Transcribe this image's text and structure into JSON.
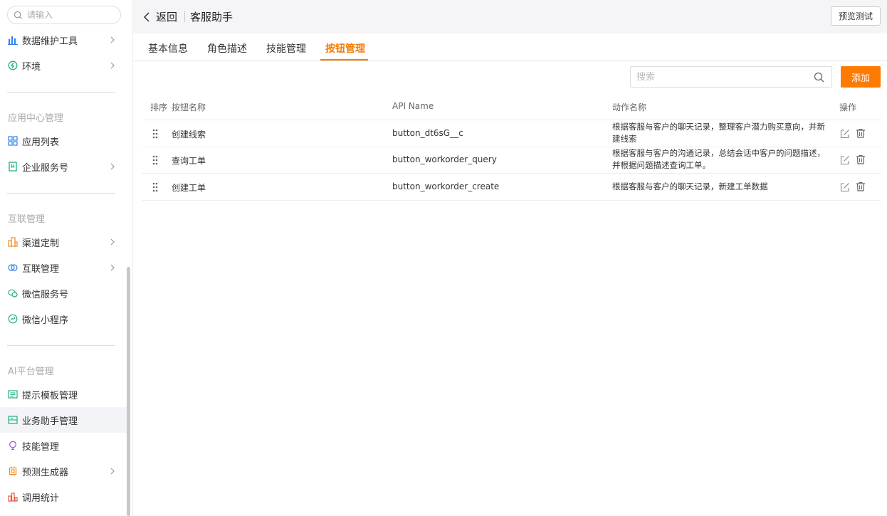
{
  "sidebar": {
    "search_placeholder": "请输入",
    "items": [
      {
        "label": "数据维护工具"
      },
      {
        "label": "环境"
      },
      {
        "label": "应用列表"
      },
      {
        "label": "企业服务号"
      },
      {
        "label": "渠道定制"
      },
      {
        "label": "互联管理"
      },
      {
        "label": "微信服务号"
      },
      {
        "label": "微信小程序"
      },
      {
        "label": "提示模板管理"
      },
      {
        "label": "业务助手管理"
      },
      {
        "label": "技能管理"
      },
      {
        "label": "预测生成器"
      },
      {
        "label": "调用统计"
      }
    ],
    "groups": [
      "应用中心管理",
      "互联管理",
      "AI平台管理"
    ]
  },
  "header": {
    "back_label": "返回",
    "title": "客服助手",
    "preview_label": "预览测试"
  },
  "tabs": [
    {
      "label": "基本信息"
    },
    {
      "label": "角色描述"
    },
    {
      "label": "技能管理"
    },
    {
      "label": "按钮管理"
    }
  ],
  "toolbar": {
    "search_placeholder": "搜索",
    "add_label": "添加"
  },
  "table": {
    "columns": [
      "排序",
      "按钮名称",
      "API Name",
      "动作名称",
      "操作"
    ],
    "rows": [
      {
        "name": "创建线索",
        "api": "button_dt6sG__c",
        "action": "根据客服与客户的聊天记录，整理客户潜力购买意向，并新建线索"
      },
      {
        "name": "查询工单",
        "api": "button_workorder_query",
        "action": "根据客服与客户的沟通记录，总结会话中客户的问题描述，并根据问题描述查询工单。"
      },
      {
        "name": "创建工单",
        "api": "button_workorder_create",
        "action": "根据客服与客户的聊天记录，新建工单数据"
      }
    ]
  },
  "colors": {
    "accent": "#ff7a00",
    "active_tab": "#f57c00"
  }
}
